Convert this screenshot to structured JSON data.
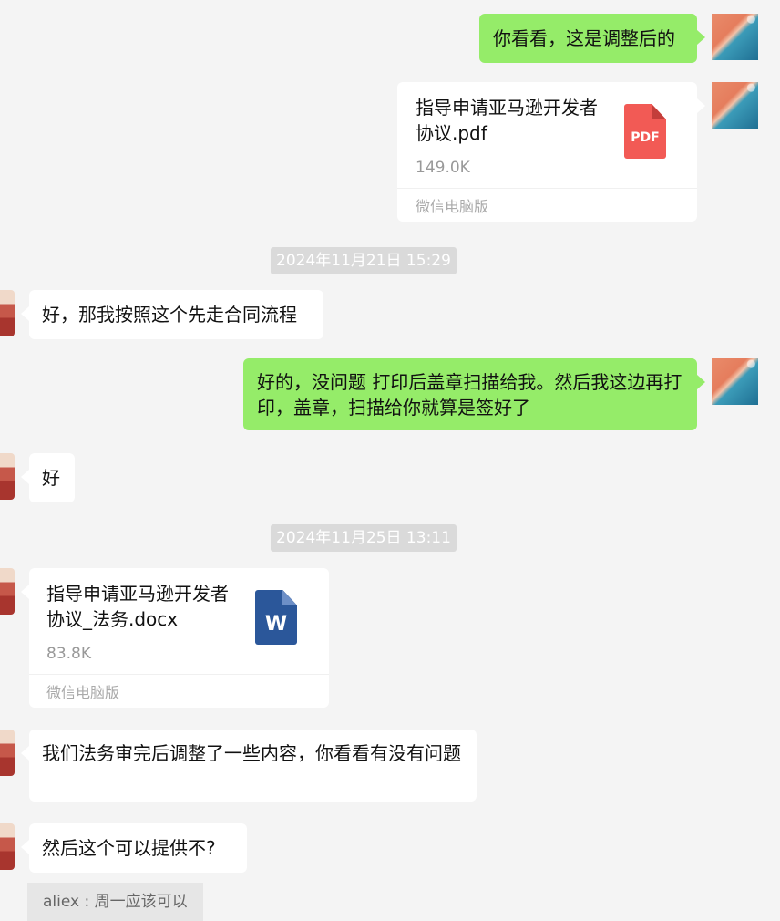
{
  "messages": {
    "m1": {
      "sender": "self",
      "text": "你看看，这是调整后的"
    },
    "m2": {
      "sender": "self",
      "type": "file",
      "file_name": "指导申请亚马逊开发者协议.pdf",
      "file_size": "149.0K",
      "file_icon": "pdf-icon",
      "icon_label": "PDF",
      "source": "微信电脑版"
    },
    "ts1": "2024年11月21日 15:29",
    "m3": {
      "sender": "other",
      "text": "好，那我按照这个先走合同流程"
    },
    "m4": {
      "sender": "self",
      "text": "好的，没问题 打印后盖章扫描给我。然后我这边再打印，盖章，扫描给你就算是签好了"
    },
    "m5": {
      "sender": "other",
      "text": "好"
    },
    "ts2": "2024年11月25日 13:11",
    "m6": {
      "sender": "other",
      "type": "file",
      "file_name": "指导申请亚马逊开发者协议_法务.docx",
      "file_size": "83.8K",
      "file_icon": "word-icon",
      "icon_label": "W",
      "source": "微信电脑版"
    },
    "m7": {
      "sender": "other",
      "text": "我们法务审完后调整了一些内容，你看看有没有问题"
    },
    "m8": {
      "sender": "other",
      "text": "然后这个可以提供不?"
    },
    "quote": "aliex : 周一应该可以"
  },
  "colors": {
    "background": "#f4f4f4",
    "self_bubble": "#95ec69",
    "other_bubble": "#ffffff",
    "timestamp_bg": "#dadada",
    "pdf_icon": "#f25a55",
    "word_icon": "#2b579a"
  }
}
